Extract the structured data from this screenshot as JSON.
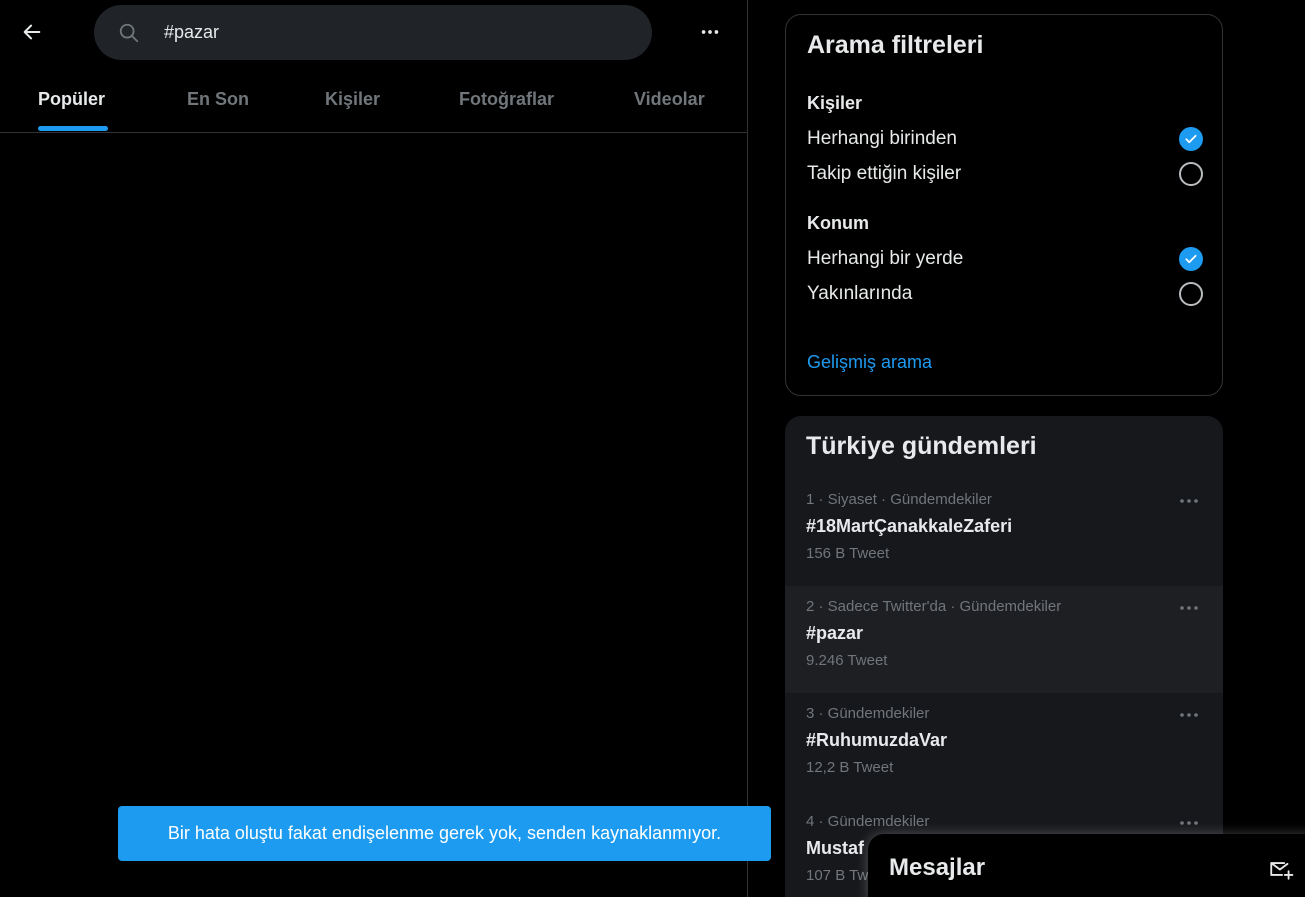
{
  "search": {
    "query": "#pazar"
  },
  "tabs": [
    {
      "label": "Popüler",
      "active": true
    },
    {
      "label": "En Son",
      "active": false
    },
    {
      "label": "Kişiler",
      "active": false
    },
    {
      "label": "Fotoğraflar",
      "active": false
    },
    {
      "label": "Videolar",
      "active": false
    }
  ],
  "toast": {
    "message": "Bir hata oluştu fakat endişelenme gerek yok, senden kaynaklanmıyor."
  },
  "filters": {
    "title": "Arama filtreleri",
    "people": {
      "heading": "Kişiler",
      "options": [
        {
          "label": "Herhangi birinden",
          "checked": true
        },
        {
          "label": "Takip ettiğin kişiler",
          "checked": false
        }
      ]
    },
    "location": {
      "heading": "Konum",
      "options": [
        {
          "label": "Herhangi bir yerde",
          "checked": true
        },
        {
          "label": "Yakınlarında",
          "checked": false
        }
      ]
    },
    "advanced_link": "Gelişmiş arama"
  },
  "trends": {
    "title": "Türkiye gündemleri",
    "items": [
      {
        "meta": "1 · Siyaset · Gündemdekiler",
        "name": "#18MartÇanakkaleZaferi",
        "count": "156 B Tweet"
      },
      {
        "meta": "2 · Sadece Twitter'da · Gündemdekiler",
        "name": "#pazar",
        "count": "9.246 Tweet"
      },
      {
        "meta": "3 · Gündemdekiler",
        "name": "#RuhumuzdaVar",
        "count": "12,2 B Tweet"
      },
      {
        "meta": "4 · Gündemdekiler",
        "name": "Mustaf",
        "count": "107 B Tw"
      }
    ]
  },
  "messages": {
    "title": "Mesajlar"
  },
  "colors": {
    "accent": "#1d9bf0",
    "background": "#000000",
    "card": "#16181c"
  }
}
